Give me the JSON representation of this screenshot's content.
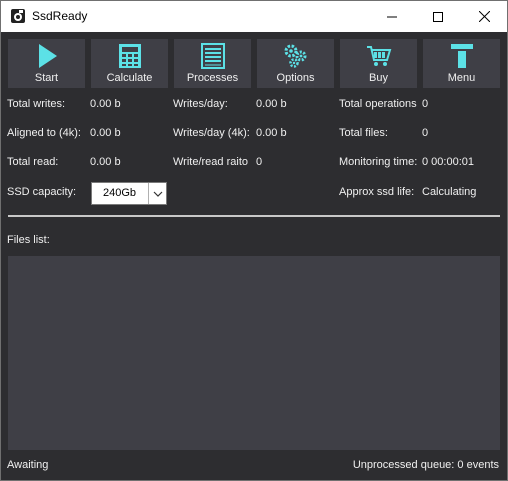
{
  "window": {
    "title": "SsdReady"
  },
  "toolbar": {
    "buttons": [
      {
        "label": "Start",
        "icon": "play-icon"
      },
      {
        "label": "Calculate",
        "icon": "calculator-icon"
      },
      {
        "label": "Processes",
        "icon": "list-icon"
      },
      {
        "label": "Options",
        "icon": "gears-icon"
      },
      {
        "label": "Buy",
        "icon": "cart-icon"
      },
      {
        "label": "Menu",
        "icon": "menu-icon"
      }
    ]
  },
  "stats": {
    "total_writes": {
      "label": "Total writes:",
      "value": "0.00 b"
    },
    "aligned": {
      "label": "Aligned to (4k):",
      "value": "0.00 b"
    },
    "total_read": {
      "label": "Total read:",
      "value": "0.00 b"
    },
    "writes_day": {
      "label": "Writes/day:",
      "value": "0.00 b"
    },
    "writes_day_4k": {
      "label": "Writes/day (4k):",
      "value": "0.00 b"
    },
    "write_read_ratio": {
      "label": "Write/read raito",
      "value": "0"
    },
    "total_operations": {
      "label": "Total operations",
      "value": "0"
    },
    "total_files": {
      "label": "Total files:",
      "value": "0"
    },
    "monitoring_time": {
      "label": "Monitoring time:",
      "value": "0 00:00:01"
    },
    "approx_life": {
      "label": "Approx ssd life:",
      "value": "Calculating"
    }
  },
  "ssd_capacity": {
    "label": "SSD capacity:",
    "value": "240Gb"
  },
  "files_list": {
    "label": "Files list:"
  },
  "status": {
    "left": "Awaiting",
    "right": "Unprocessed queue: 0 events"
  },
  "colors": {
    "accent": "#5ce1e6",
    "background": "#2d2d30",
    "panel": "#3f3f46"
  }
}
